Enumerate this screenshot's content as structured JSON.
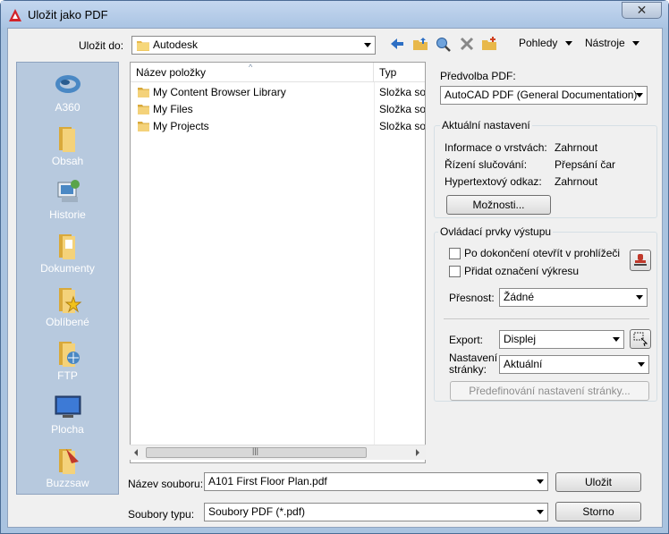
{
  "window": {
    "title": "Uložit jako PDF",
    "close_glyph": "✕"
  },
  "toolbar": {
    "save_in_label": "Uložit do:",
    "location": "Autodesk",
    "views_label": "Pohledy",
    "tools_label": "Nástroje"
  },
  "sidebar": {
    "items": [
      {
        "label": "A360",
        "icon": "a360-icon"
      },
      {
        "label": "Obsah",
        "icon": "folder-icon"
      },
      {
        "label": "Historie",
        "icon": "history-icon"
      },
      {
        "label": "Dokumenty",
        "icon": "documents-icon"
      },
      {
        "label": "Oblíbené",
        "icon": "favorites-icon"
      },
      {
        "label": "FTP",
        "icon": "ftp-icon"
      },
      {
        "label": "Plocha",
        "icon": "desktop-icon"
      },
      {
        "label": "Buzzsaw",
        "icon": "buzzsaw-icon"
      }
    ]
  },
  "filelist": {
    "columns": [
      "Název položky",
      "Typ"
    ],
    "rows": [
      {
        "name": "My Content Browser Library",
        "type": "Složka souborů"
      },
      {
        "name": "My Files",
        "type": "Složka souborů"
      },
      {
        "name": "My Projects",
        "type": "Složka souborů"
      }
    ]
  },
  "pdf": {
    "preset_label": "Předvolba PDF:",
    "preset_value": "AutoCAD PDF (General Documentation)",
    "current_settings_legend": "Aktuální nastavení",
    "settings": [
      {
        "key": "Informace o vrstvách:",
        "value": "Zahrnout"
      },
      {
        "key": "Řízení slučování:",
        "value": "Přepsání čar"
      },
      {
        "key": "Hypertextový odkaz:",
        "value": "Zahrnout"
      }
    ],
    "options_button": "Možnosti...",
    "output_legend": "Ovládací prvky výstupu",
    "open_after_label": "Po dokončení otevřít v prohlížeči",
    "add_stamp_label": "Přidat označení výkresu",
    "precision_label": "Přesnost:",
    "precision_value": "Žádné",
    "export_label": "Export:",
    "export_value": "Displej",
    "page_setup_label_1": "Nastavení",
    "page_setup_label_2": "stránky:",
    "page_setup_value": "Aktuální",
    "page_setup_override_button": "Předefinování nastavení stránky..."
  },
  "footer": {
    "filename_label": "Název souboru:",
    "filename_value": "A101 First Floor Plan.pdf",
    "filetype_label": "Soubory typu:",
    "filetype_value": "Soubory PDF (*.pdf)",
    "save_button": "Uložit",
    "cancel_button": "Storno"
  }
}
